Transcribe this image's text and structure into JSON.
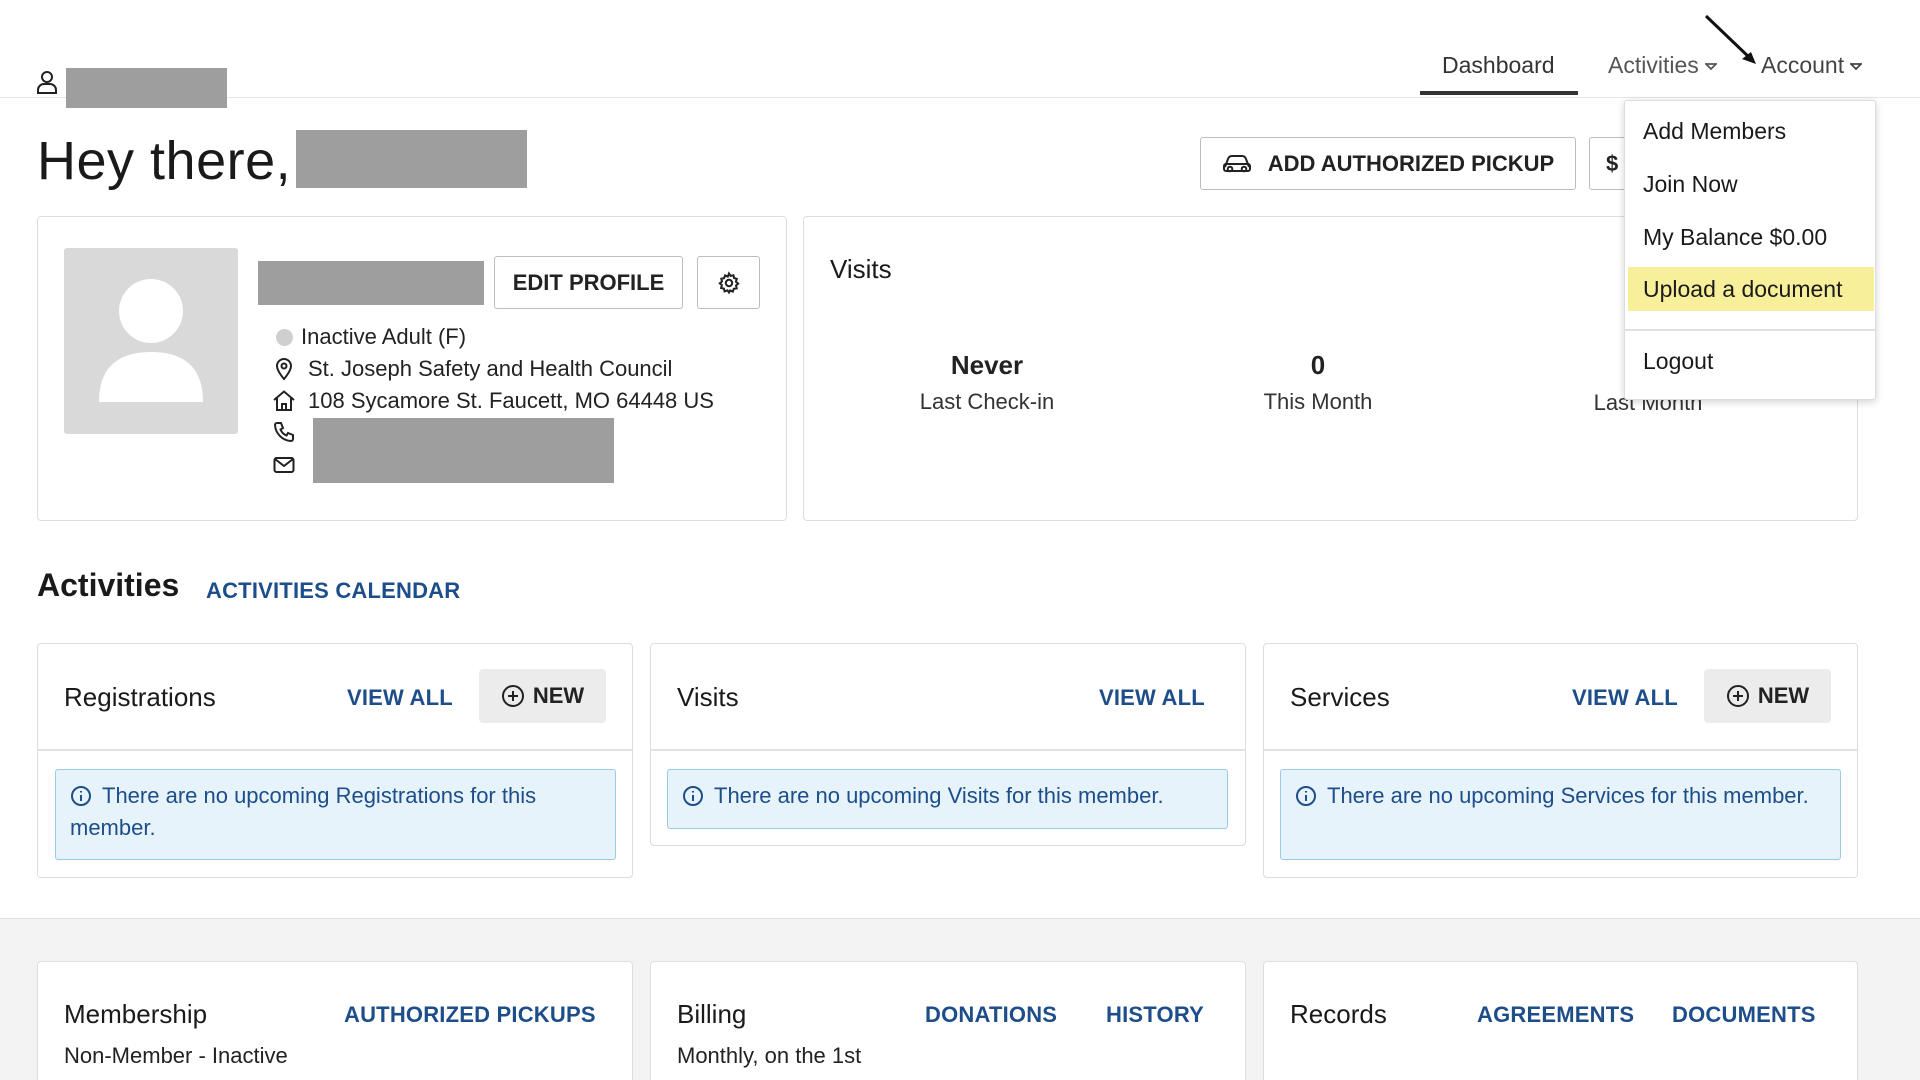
{
  "nav": {
    "tabs": [
      {
        "label": "Dashboard"
      },
      {
        "label": "Activities"
      },
      {
        "label": "Account"
      }
    ]
  },
  "greeting": "Hey there,",
  "buttons": {
    "add_pickup": "ADD AUTHORIZED PICKUP",
    "second_action_partial": "$",
    "edit_profile": "EDIT PROFILE"
  },
  "profile": {
    "status": "Inactive Adult (F)",
    "organization": "St. Joseph Safety and Health Council",
    "address": "108 Sycamore St. Faucett, MO 64448 US"
  },
  "visits_summary": {
    "title": "Visits",
    "stats": [
      {
        "value": "Never",
        "label": "Last Check-in"
      },
      {
        "value": "0",
        "label": "This Month"
      },
      {
        "value": "",
        "label": "Last Month"
      }
    ]
  },
  "activities": {
    "title": "Activities",
    "calendar_link": "ACTIVITIES CALENDAR",
    "panels": [
      {
        "title": "Registrations",
        "view_all": "VIEW ALL",
        "new": "NEW",
        "message": "There are no upcoming Registrations for this member."
      },
      {
        "title": "Visits",
        "view_all": "VIEW ALL",
        "message": "There are no upcoming Visits for this member."
      },
      {
        "title": "Services",
        "view_all": "VIEW ALL",
        "new": "NEW",
        "message": "There are no upcoming Services for this member."
      }
    ]
  },
  "bottom": {
    "membership": {
      "title": "Membership",
      "link": "AUTHORIZED PICKUPS",
      "text": "Non-Member - Inactive"
    },
    "billing": {
      "title": "Billing",
      "link1": "DONATIONS",
      "link2": "HISTORY",
      "text": "Monthly, on the 1st"
    },
    "records": {
      "title": "Records",
      "link1": "AGREEMENTS",
      "link2": "DOCUMENTS"
    }
  },
  "account_menu": {
    "items": [
      "Add Members",
      "Join Now",
      "My Balance $0.00",
      "Upload a document",
      "Logout"
    ]
  },
  "colors": {
    "link": "#1d4e89",
    "highlight": "#f8ef9a",
    "info_bg": "#e7f3fb",
    "redaction": "#9e9e9e"
  }
}
